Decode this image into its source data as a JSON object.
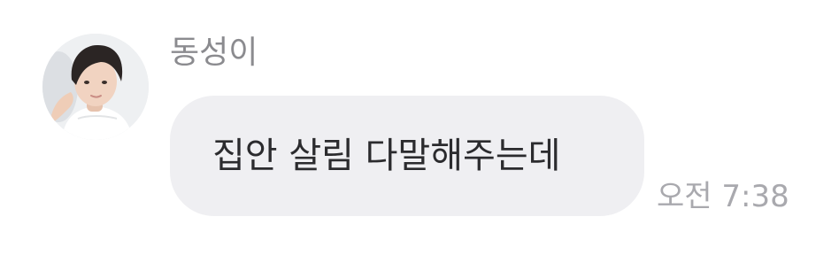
{
  "message": {
    "sender_name": "동성이",
    "text": "집안 살림 다말해주는데",
    "time": "오전 7:38"
  },
  "colors": {
    "background": "#ffffff",
    "bubble": "#efeff2",
    "sender_name": "#8b8b8f",
    "message_text": "#2b2b2e",
    "timestamp": "#a9a9ae"
  },
  "icons": {
    "avatar": "profile-photo"
  }
}
